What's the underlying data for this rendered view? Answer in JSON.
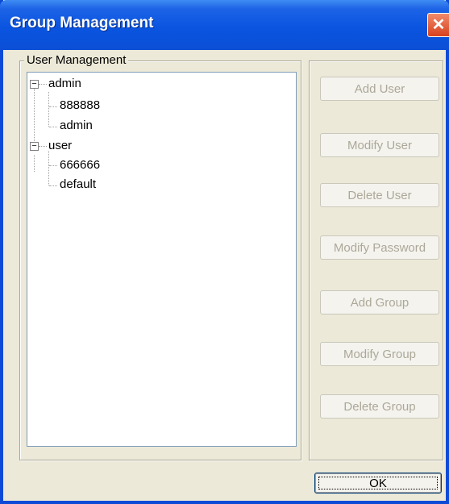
{
  "window": {
    "title": "Group Management",
    "close_glyph": "✕"
  },
  "group_box": {
    "label": "User Management"
  },
  "tree": [
    {
      "label": "admin",
      "expander": "−",
      "children": [
        "888888",
        "admin"
      ]
    },
    {
      "label": "user",
      "expander": "−",
      "children": [
        "666666",
        "default"
      ]
    }
  ],
  "buttons": {
    "add_user": "Add User",
    "modify_user": "Modify User",
    "delete_user": "Delete User",
    "modify_password": "Modify Password",
    "add_group": "Add Group",
    "modify_group": "Modify Group",
    "delete_group": "Delete Group",
    "ok": "OK"
  },
  "colors": {
    "titlebar": "#0b4fd5",
    "dialog_bg": "#ece9d8",
    "disabled_text": "#aca899"
  }
}
